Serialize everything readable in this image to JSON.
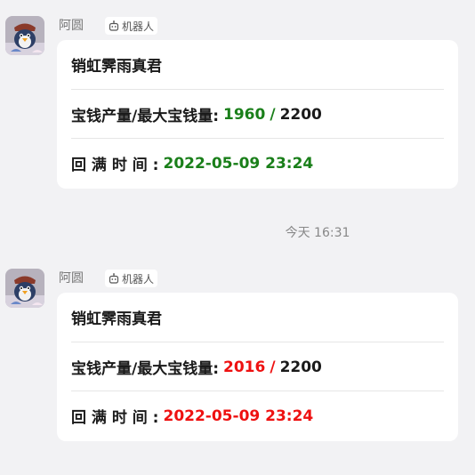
{
  "messages": [
    {
      "sender": "阿圆",
      "badge": "机器人",
      "card": {
        "title": "销虹霁雨真君",
        "storage_label": "宝钱产量/最大宝钱量:",
        "storage_current": "1960",
        "storage_sep": "/",
        "storage_max": "2200",
        "refill_label": "回 满 时 间 :",
        "refill_time": "2022-05-09 23:24",
        "value_color": "#1a7f1a"
      }
    },
    {
      "sender": "阿圆",
      "badge": "机器人",
      "card": {
        "title": "销虹霁雨真君",
        "storage_label": "宝钱产量/最大宝钱量:",
        "storage_current": "2016",
        "storage_sep": "/",
        "storage_max": "2200",
        "refill_label": "回 满 时 间 :",
        "refill_time": "2022-05-09 23:24",
        "value_color": "#ee1111"
      }
    }
  ],
  "timestamp": "今天 16:31",
  "icons": {
    "avatar": "avatar-penguin",
    "badge": "robot-icon"
  }
}
